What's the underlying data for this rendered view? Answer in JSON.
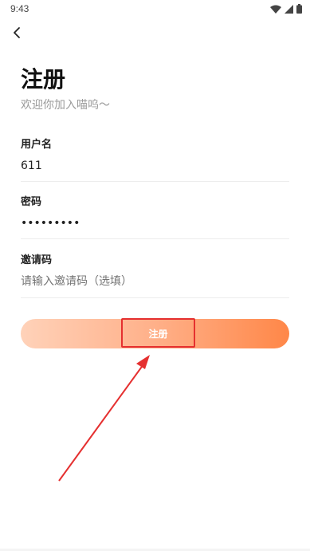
{
  "status_bar": {
    "time": "9:43",
    "icons": [
      "wifi-icon",
      "signal-icon",
      "battery-icon"
    ]
  },
  "header": {
    "back_icon": "chevron-left-icon",
    "title": "注册",
    "subtitle": "欢迎你加入喵呜～"
  },
  "form": {
    "username": {
      "label": "用户名",
      "value": "611"
    },
    "password": {
      "label": "密码",
      "value": "•••••••••"
    },
    "invite_code": {
      "label": "邀请码",
      "placeholder": "请输入邀请码（选填）"
    }
  },
  "register_button": {
    "label": "注册"
  },
  "colors": {
    "button_gradient_start": "#ffd2b9",
    "button_gradient_end": "#ff8748",
    "annotation_red": "#e53030",
    "subtitle_gray": "#9a9a9a"
  }
}
